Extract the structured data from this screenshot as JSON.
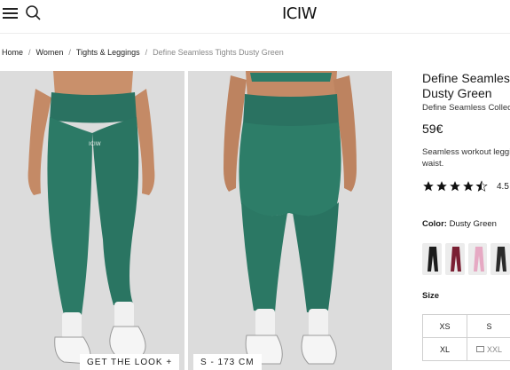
{
  "header": {
    "logo": "ICIW",
    "menu_icon": "hamburger-menu-icon",
    "search_icon": "search-icon"
  },
  "breadcrumb": {
    "items": [
      "Home",
      "Women",
      "Tights & Leggings"
    ],
    "current": "Define Seamless Tights Dusty Green",
    "separator": "/"
  },
  "gallery": {
    "tag_look": "GET THE LOOK +",
    "tag_model": "S - 173 CM",
    "product_color": "#2c7a66"
  },
  "product": {
    "title_line1": "Define Seamless Tights",
    "title_line2": "Dusty Green",
    "collection": "Define Seamless Collection",
    "price": "59€",
    "desc_line1": "Seamless workout leggings with high waist.",
    "desc_line2": "waist.",
    "rating_stars": 4.5,
    "rating_value": "4.5",
    "color_label": "Color:",
    "color_value": "Dusty Green",
    "swatch_colors": [
      "#1c1c1c",
      "#7a1f33",
      "#e6a9c3",
      "#2a2a2a"
    ],
    "size_label": "Size",
    "sizes": [
      "XS",
      "S",
      "XL",
      "XXL"
    ]
  }
}
